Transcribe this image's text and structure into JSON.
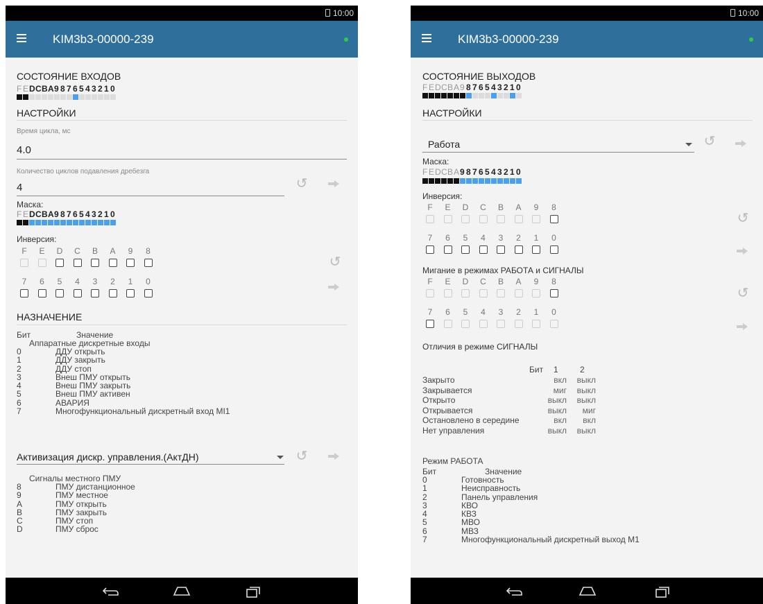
{
  "statusbar": {
    "time": "10:00"
  },
  "app": {
    "title": "KIM3b3-00000-239",
    "status_color": "#2ecc40",
    "accent": "#2e6f9c"
  },
  "bit_labels_16": [
    "F",
    "E",
    "D",
    "C",
    "B",
    "A",
    "9",
    "8",
    "7",
    "6",
    "5",
    "4",
    "3",
    "2",
    "1",
    "0"
  ],
  "left": {
    "inputs_header": "СОСТОЯНИЕ ВХОДОВ",
    "inputs_state": [
      "black",
      "black",
      "grey",
      "grey",
      "grey",
      "grey",
      "grey",
      "grey",
      "grey",
      "blue",
      "grey",
      "grey",
      "grey",
      "grey",
      "grey",
      "grey"
    ],
    "settings_header": "НАСТРОЙКИ",
    "cycle_time_label": "Время цикла, мс",
    "cycle_time_value": "4.0",
    "debounce_label": "Количество циклов подавления дребезга",
    "debounce_value": "4",
    "mask_label": "Маска:",
    "mask_state": [
      "black",
      "black",
      "blue",
      "blue",
      "blue",
      "blue",
      "blue",
      "blue",
      "blue",
      "blue",
      "blue",
      "blue",
      "blue",
      "blue",
      "blue",
      "blue"
    ],
    "inversion_label": "Инверсия:",
    "inversion_high_labels": [
      "F",
      "E",
      "D",
      "C",
      "B",
      "A",
      "9",
      "8"
    ],
    "inversion_low_labels": [
      "7",
      "6",
      "5",
      "4",
      "3",
      "2",
      "1",
      "0"
    ],
    "assignment_header": "НАЗНАЧЕНИЕ",
    "table_head_bit": "Бит",
    "table_head_value": "Значение",
    "hw_inputs_title": "Аппаратные дискретные входы",
    "hw_inputs": [
      {
        "bit": "0",
        "value": "ДДУ открыть"
      },
      {
        "bit": "1",
        "value": "ДДУ закрыть"
      },
      {
        "bit": "2",
        "value": "ДДУ стоп"
      },
      {
        "bit": "3",
        "value": "Внеш ПМУ открыть"
      },
      {
        "bit": "4",
        "value": "Внеш ПМУ закрыть"
      },
      {
        "bit": "5",
        "value": "Внеш ПМУ активен"
      },
      {
        "bit": "6",
        "value": "АВАРИЯ"
      },
      {
        "bit": "7",
        "value": "Многофункциональный дискретный вход МI1"
      }
    ],
    "activation_select": "Активизация дискр. управления.(АктДН)",
    "local_signals_title": "Сигналы местного ПМУ",
    "local_signals": [
      {
        "bit": "8",
        "value": "ПМУ дистанционное"
      },
      {
        "bit": "9",
        "value": "ПМУ местное"
      },
      {
        "bit": "A",
        "value": "ПМУ открыть"
      },
      {
        "bit": "B",
        "value": "ПМУ закрыть"
      },
      {
        "bit": "C",
        "value": "ПМУ стоп"
      },
      {
        "bit": "D",
        "value": "ПМУ сброс"
      }
    ]
  },
  "right": {
    "outputs_header": "СОСТОЯНИЕ ВЫХОДОВ",
    "outputs_state": [
      "black",
      "black",
      "black",
      "black",
      "black",
      "black",
      "black",
      "blue",
      "grey",
      "grey",
      "grey",
      "blue",
      "grey",
      "grey",
      "blue",
      "grey"
    ],
    "settings_header": "НАСТРОЙКИ",
    "mode_select": "Работа",
    "mask_label": "Маска:",
    "mask_state": [
      "black",
      "black",
      "black",
      "black",
      "black",
      "black",
      "blue",
      "blue",
      "blue",
      "blue",
      "blue",
      "blue",
      "blue",
      "blue",
      "blue",
      "blue"
    ],
    "inversion_label": "Инверсия:",
    "blink_label": "Мигание в режимах РАБОТА и СИГНАЛЫ",
    "signals_diff_label": "Отличия в режиме СИГНАЛЫ",
    "diff_head": {
      "bit": "Бит",
      "c1": "1",
      "c2": "2"
    },
    "diff_rows": [
      {
        "name": "Закрыто",
        "c1": "вкл",
        "c2": "выкл"
      },
      {
        "name": "Закрывается",
        "c1": "миг",
        "c2": "выкл"
      },
      {
        "name": "Открыто",
        "c1": "выкл",
        "c2": "выкл"
      },
      {
        "name": "Открывается",
        "c1": "выкл",
        "c2": "миг"
      },
      {
        "name": "Остановлено в середине",
        "c1": "вкл",
        "c2": "вкл"
      },
      {
        "name": "Нет управления",
        "c1": "выкл",
        "c2": "выкл"
      }
    ],
    "work_mode_title": "Режим РАБОТА",
    "work_head_bit": "Бит",
    "work_head_value": "Значение",
    "work_rows": [
      {
        "bit": "0",
        "value": "Готовность"
      },
      {
        "bit": "1",
        "value": "Неисправность"
      },
      {
        "bit": "2",
        "value": "Панель управления"
      },
      {
        "bit": "3",
        "value": "КВО"
      },
      {
        "bit": "4",
        "value": "КВЗ"
      },
      {
        "bit": "5",
        "value": "МВО"
      },
      {
        "bit": "6",
        "value": "МВЗ"
      },
      {
        "bit": "7",
        "value": "Многофункциональный дискретный выход М1"
      }
    ]
  }
}
